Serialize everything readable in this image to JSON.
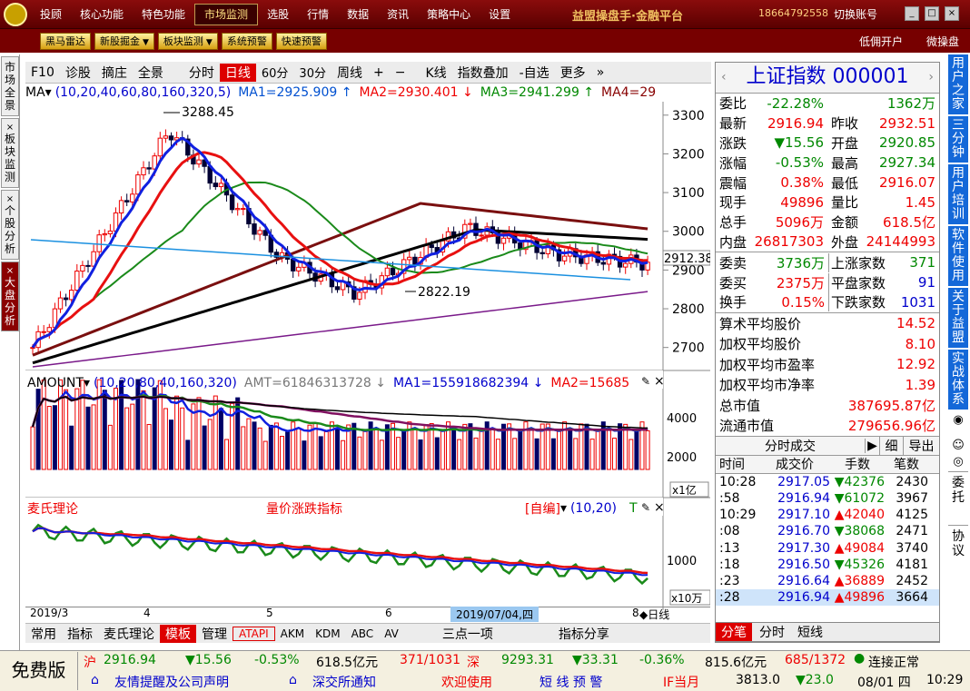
{
  "menu": {
    "items": [
      "投顾",
      "核心功能",
      "特色功能",
      "市场监测",
      "选股",
      "行情",
      "数据",
      "资讯",
      "策略中心",
      "设置"
    ],
    "active": "市场监测"
  },
  "brand": "益盟操盘手·金融平台",
  "phone": "18664792558",
  "switch_account": "切换账号",
  "toolbar": {
    "buttons": [
      "黑马雷达",
      "新股掘金",
      "板块监测",
      "系统预警",
      "快速预警"
    ],
    "right": [
      "低佣开户",
      "微操盘"
    ]
  },
  "left_tabs": [
    "市场全景",
    "板块监测",
    "个股分析",
    "大盘分析"
  ],
  "chart_toolbar": {
    "items": [
      "F10",
      "诊股",
      "摘庄",
      "全景",
      "分时",
      "日线",
      "60分",
      "30分",
      "周线",
      "+",
      "−",
      "K线",
      "指数叠加",
      "-自选",
      "更多",
      "»"
    ],
    "active": "日线"
  },
  "ma_legend": {
    "label": "MA",
    "params": "(10,20,40,60,80,160,320,5)",
    "ma1": "MA1=2925.909 ↑",
    "ma2": "MA2=2930.401 ↓",
    "ma3": "MA3=2941.299 ↑",
    "ma4": "MA4=29"
  },
  "amount_legend": {
    "label": "AMOUNT",
    "params": "(10,20,80,40,160,320)",
    "amt": "AMT=61846313728 ↓",
    "ma1": "MA1=155918682394 ↓",
    "ma2": "MA2=15685"
  },
  "mai_panel": {
    "title": "麦氏理论",
    "indicator": "量价涨跌指标",
    "auto_edit": "[自编]",
    "params": "(10,20)",
    "tag": "T"
  },
  "chart_labels": {
    "high": "3288.45",
    "low": "2822.19",
    "cur": "2912.38",
    "unit1": "x1亿",
    "unit2": "x10万",
    "vol_ticks": [
      "4000",
      "2000"
    ],
    "mai_tick": "1000"
  },
  "price_axis": [
    "3300",
    "3200",
    "3100",
    "3000",
    "2900",
    "2800",
    "2700"
  ],
  "x_axis": [
    "2019/3",
    "4",
    "5",
    "6",
    "7",
    "8"
  ],
  "x_highlight": "2019/07/04,四",
  "daily_label": "◆日线",
  "bottom_tabs": [
    "常用",
    "指标",
    "麦氏理论",
    "模板",
    "管理",
    "ATAPI",
    "AKM",
    "KDM",
    "ABC",
    "AV",
    "三点一项",
    "指标分享"
  ],
  "bottom_active": "模板",
  "quote": {
    "title": "上证指数 000001",
    "rows": [
      [
        "委比",
        "-22.28%",
        "",
        "1362万"
      ],
      [
        "最新",
        "2916.94",
        "昨收",
        "2932.51"
      ],
      [
        "涨跌",
        "▼15.56",
        "开盘",
        "2920.85"
      ],
      [
        "涨幅",
        "-0.53%",
        "最高",
        "2927.34"
      ],
      [
        "震幅",
        "0.38%",
        "最低",
        "2916.07"
      ],
      [
        "现手",
        "49896",
        "量比",
        "1.45"
      ],
      [
        "总手",
        "5096万",
        "金额",
        "618.5亿"
      ],
      [
        "内盘",
        "26817303",
        "外盘",
        "24144993"
      ]
    ],
    "rows2": [
      [
        "委卖",
        "3736万",
        "上涨家数",
        "371"
      ],
      [
        "委买",
        "2375万",
        "平盘家数",
        "91"
      ],
      [
        "换手",
        "0.15%",
        "下跌家数",
        "1031"
      ]
    ],
    "stats": [
      [
        "算术平均股价",
        "14.52"
      ],
      [
        "加权平均股价",
        "8.10"
      ],
      [
        "加权平均市盈率",
        "12.92"
      ],
      [
        "加权平均市净率",
        "1.39"
      ],
      [
        "总市值",
        "387695.87亿"
      ],
      [
        "流通市值",
        "279656.96亿"
      ]
    ]
  },
  "ticks": {
    "title": "分时成交",
    "btn1": "细",
    "btn2": "导出",
    "headers": [
      "时间",
      "成交价",
      "手数",
      "笔数"
    ],
    "rows": [
      [
        "10:28",
        "2917.05",
        "▼42376",
        "2430"
      ],
      [
        ":58",
        "2916.94",
        "▼61072",
        "3967"
      ],
      [
        "10:29",
        "2917.10",
        "▲42040",
        "4125"
      ],
      [
        ":08",
        "2916.70",
        "▼38068",
        "2471"
      ],
      [
        ":13",
        "2917.30",
        "▲49084",
        "3740"
      ],
      [
        ":18",
        "2916.50",
        "▼45326",
        "4181"
      ],
      [
        ":23",
        "2916.64",
        "▲36889",
        "2452"
      ],
      [
        ":28",
        "2916.94",
        "▲49896",
        "3664"
      ]
    ]
  },
  "right_bottom_tabs": [
    "分笔",
    "分时",
    "短线"
  ],
  "right_tabs": [
    "用户之家",
    "三分钟",
    "用户培训",
    "软件使用",
    "关于益盟",
    "实战体系"
  ],
  "right_icons": [
    "委托",
    "协议"
  ],
  "status": {
    "free": "免费版",
    "sh_label": "沪",
    "sh": "2916.94",
    "sh_chg": "▼15.56",
    "sh_pct": "-0.53%",
    "sh_amt": "618.5亿元",
    "sh_ud": "371/1031",
    "sz_label": "深",
    "sz": "9293.31",
    "sz_chg": "▼33.31",
    "sz_pct": "-0.36%",
    "sz_amt": "815.6亿元",
    "sz_ud": "685/1372",
    "conn": "连接正常",
    "notice1": "友情提醒及公司声明",
    "notice2": "深交所通知",
    "welcome": "欢迎使用",
    "alert": "短 线 预 警",
    "if": "IF当月",
    "if_val": "3813.0",
    "if_chg": "▼23.0",
    "date": "08/01 四",
    "time": "10:29"
  },
  "chart_data": {
    "type": "candlestick",
    "ylim": [
      2650,
      3330
    ],
    "ticks": [
      3300,
      3200,
      3100,
      3000,
      2900,
      2800,
      2700
    ],
    "high": 3288.45,
    "low": 2822.19,
    "last": 2912.38
  }
}
